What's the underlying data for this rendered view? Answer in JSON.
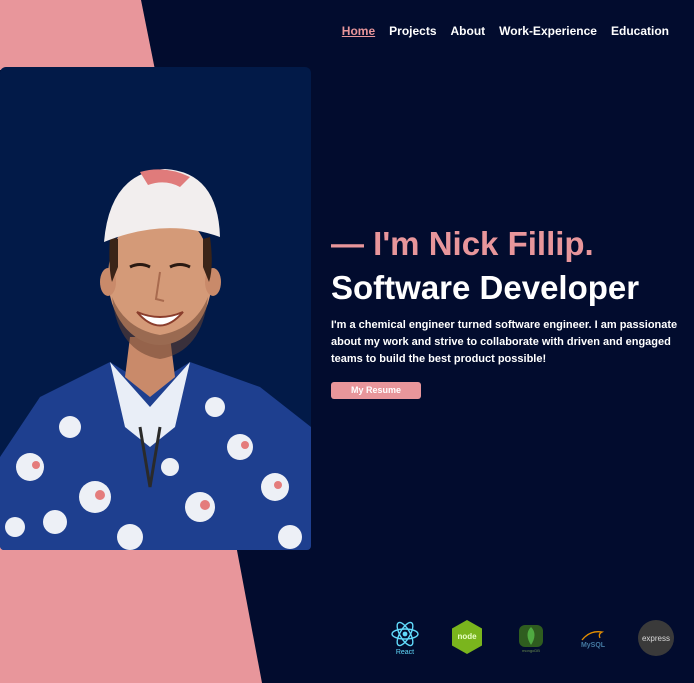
{
  "nav": {
    "items": [
      {
        "label": "Home",
        "active": true
      },
      {
        "label": "Projects",
        "active": false
      },
      {
        "label": "About",
        "active": false
      },
      {
        "label": "Work-Experience",
        "active": false
      },
      {
        "label": "Education",
        "active": false
      }
    ]
  },
  "hero": {
    "greeting": "— I'm Nick Fillip.",
    "role": "Software Developer",
    "bio": "I'm a chemical engineer turned software engineer. I am passionate about my work and strive to collaborate with driven and engaged teams to build the best product possible!",
    "resume_button": "My Resume"
  },
  "tech_logos": {
    "react": "React",
    "node": "node",
    "mongodb": "mongoDB",
    "mysql": "MySQL",
    "express": "express"
  },
  "colors": {
    "background": "#020c2e",
    "accent": "#e8969b",
    "photo_bg": "#021a48",
    "text": "#ffffff"
  }
}
